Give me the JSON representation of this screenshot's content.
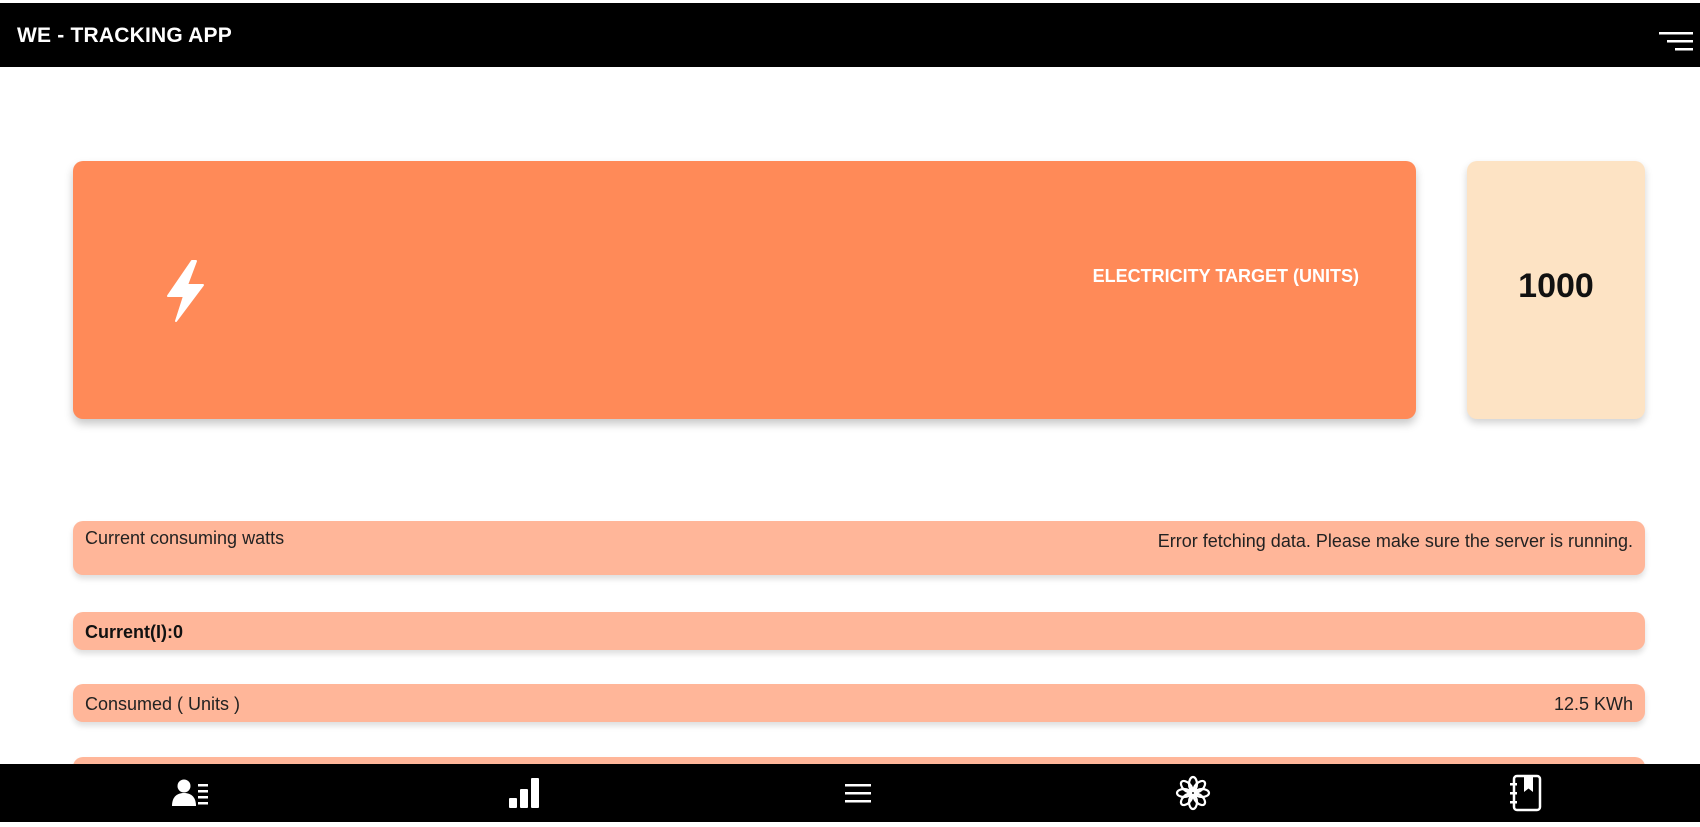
{
  "header": {
    "title": "WE - TRACKING APP",
    "menu_icon": "menu-lines-icon"
  },
  "target_card": {
    "icon": "lightning-bolt-icon",
    "label": "ELECTRICITY TARGET (UNITS)",
    "value": "1000",
    "card_color": "#ff8a58",
    "value_card_color": "#fde3c4"
  },
  "readings": {
    "watts_label": "Current consuming watts",
    "watts_value": "Error fetching data. Please make sure the server is running.",
    "current_label": "Current(I):0",
    "consumed_label": "Consumed ( Units )",
    "consumed_value": "12.5 KWh",
    "row_color": "#ffb699"
  },
  "bottom_nav": {
    "items": [
      {
        "icon": "profile-list-icon"
      },
      {
        "icon": "bar-chart-icon"
      },
      {
        "icon": "menu-icon"
      },
      {
        "icon": "flower-icon"
      },
      {
        "icon": "notebook-bookmark-icon"
      }
    ]
  }
}
